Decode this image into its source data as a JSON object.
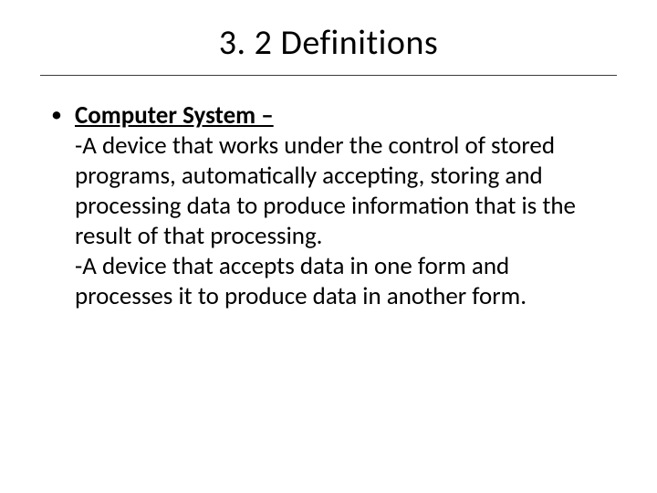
{
  "title": "3. 2 Definitions",
  "bullet": {
    "term": "Computer System –",
    "def1": "-A device that works under the control of stored programs, automatically accepting, storing and processing data to produce information that is the result of that processing.",
    "def2": "-A device that accepts data in one form and processes it to produce data in another form."
  }
}
